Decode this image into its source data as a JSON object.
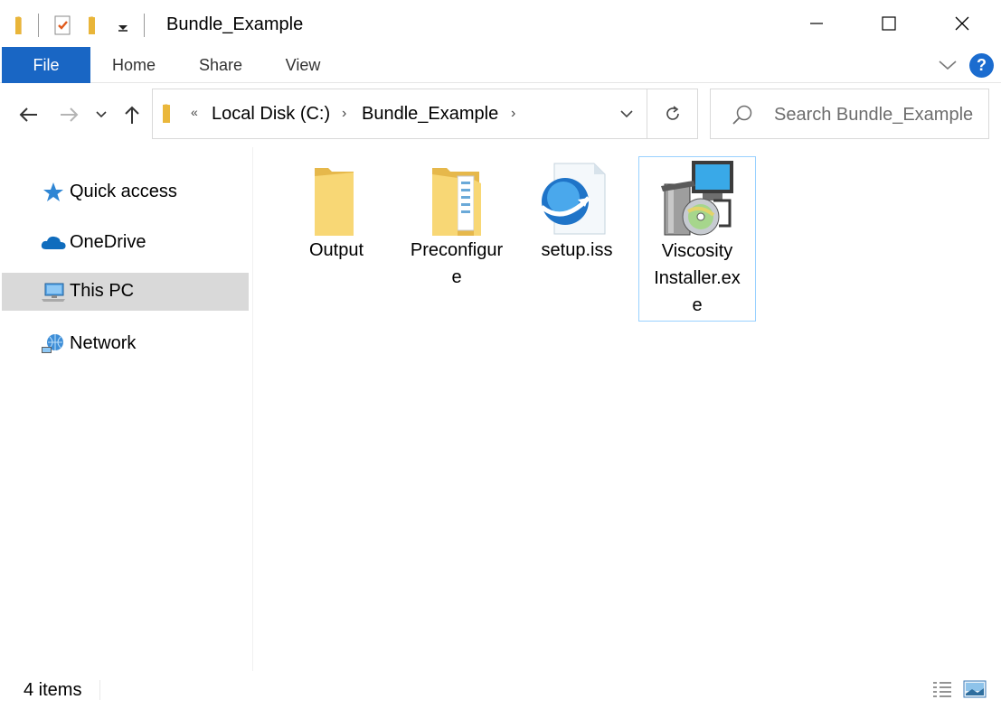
{
  "window": {
    "title": "Bundle_Example"
  },
  "ribbon": {
    "tabs": [
      {
        "label": "File",
        "active": true
      },
      {
        "label": "Home"
      },
      {
        "label": "Share"
      },
      {
        "label": "View"
      }
    ],
    "accent_color": "#1966c4"
  },
  "address": {
    "overflow": "«",
    "crumbs": [
      "Local Disk (C:)",
      "Bundle_Example"
    ],
    "separator": "›"
  },
  "search": {
    "placeholder": "Search Bundle_Example"
  },
  "navpane": {
    "items": [
      {
        "label": "Quick access",
        "icon": "star-icon"
      },
      {
        "label": "OneDrive",
        "icon": "cloud-icon"
      },
      {
        "label": "This PC",
        "icon": "computer-icon",
        "selected": true
      },
      {
        "label": "Network",
        "icon": "network-icon"
      }
    ]
  },
  "files": [
    {
      "lines": [
        "Output"
      ],
      "icon": "folder-icon"
    },
    {
      "lines": [
        "Preconfigur",
        "e"
      ],
      "icon": "folder-documents-icon"
    },
    {
      "lines": [
        "setup.iss"
      ],
      "icon": "inno-setup-icon"
    },
    {
      "lines": [
        "Viscosity",
        "Installer.ex",
        "e"
      ],
      "icon": "installer-icon",
      "selected": true
    }
  ],
  "status": {
    "item_count": "4 items"
  }
}
